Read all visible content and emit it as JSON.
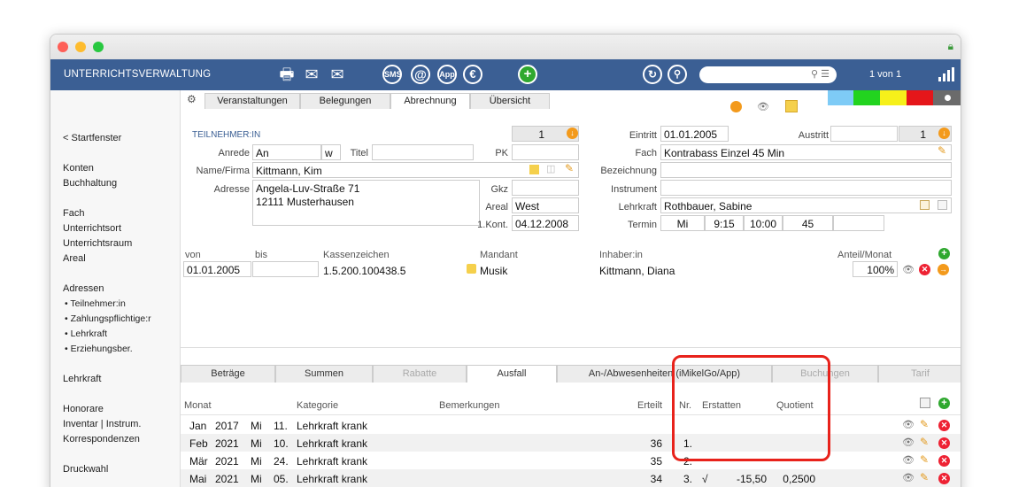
{
  "app": {
    "title": "UNTERRICHTSVERWALTUNG",
    "pager": "1 von 1",
    "search_placeholder": ""
  },
  "toolbar": {
    "sms": "SMS",
    "at": "@",
    "app": "App",
    "euro": "€",
    "plus": "+"
  },
  "sidebar": {
    "items": [
      "< Startfenster",
      "Konten",
      "Buchhaltung",
      "Fach",
      "Unterrichtsort",
      "Unterrichtsraum",
      "Areal",
      "Adressen",
      "• Teilnehmer:in",
      "• Zahlungspflichtige:r",
      "• Lehrkraft",
      "• Erziehungsber.",
      "Lehrkraft",
      "Honorare",
      "Inventar | Instrum.",
      "Korrespondenzen",
      "Druckwahl"
    ]
  },
  "tabs": [
    "Veranstaltungen",
    "Belegungen",
    "Abrechnung",
    "Übersicht"
  ],
  "swatch_colors": [
    "#7ecbf6",
    "#22d31f",
    "#f6f01a",
    "#e5161a",
    "#6b6b6b"
  ],
  "form": {
    "section": "TEILNEHMER:IN",
    "counter": "1",
    "anrede_label": "Anrede",
    "anrede": "An",
    "w": "w",
    "titel_label": "Titel",
    "titel": "",
    "pk_label": "PK",
    "pk": "",
    "name_label": "Name/Firma",
    "name": "Kittmann, Kim",
    "adresse_label": "Adresse",
    "street": "Angela-Luv-Straße 71",
    "city": "12111 Musterhausen",
    "gkz_label": "Gkz",
    "gkz": "",
    "areal_label": "Areal",
    "areal": "West",
    "kont_label": "1.Kont.",
    "kont": "04.12.2008",
    "eintritt_label": "Eintritt",
    "eintritt": "01.01.2005",
    "austritt_label": "Austritt",
    "austritt": "",
    "austritt_counter": "1",
    "fach_label": "Fach",
    "fach": "Kontrabass Einzel 45 Min",
    "bezeichnung_label": "Bezeichnung",
    "bezeichnung": "",
    "instrument_label": "Instrument",
    "instrument": "",
    "lehrkraft_label": "Lehrkraft",
    "lehrkraft": "Rothbauer, Sabine",
    "termin_label": "Termin",
    "termin_day": "Mi",
    "termin_from": "9:15",
    "termin_to": "10:00",
    "termin_min": "45"
  },
  "payment": {
    "headers": {
      "von": "von",
      "bis": "bis",
      "kassenzeichen": "Kassenzeichen",
      "mandant": "Mandant",
      "inhaber": "Inhaber:in",
      "anteil": "Anteil/Monat"
    },
    "row": {
      "von": "01.01.2005",
      "bis": "",
      "kassenzeichen": "1.5.200.100438.5",
      "mandant": "Musik",
      "inhaber": "Kittmann, Diana",
      "anteil": "100%"
    }
  },
  "bottom_tabs": [
    "Beträge",
    "Summen",
    "Rabatte",
    "Ausfall",
    "An-/Abwesenheiten (iMikelGo/App)",
    "Buchungen",
    "Tarif"
  ],
  "ausfall": {
    "headers": {
      "monat": "Monat",
      "kategorie": "Kategorie",
      "bemerkungen": "Bemerkungen",
      "erteilt": "Erteilt",
      "nr": "Nr.",
      "erstatten": "Erstatten",
      "quotient": "Quotient"
    },
    "rows": [
      {
        "month": "Jan",
        "year": "2017",
        "day": "Mi",
        "date": "11.",
        "category": "Lehrkraft krank",
        "erteilt": "",
        "nr": "",
        "check": "",
        "erstatten": "",
        "quotient": ""
      },
      {
        "month": "Feb",
        "year": "2021",
        "day": "Mi",
        "date": "10.",
        "category": "Lehrkraft krank",
        "erteilt": "36",
        "nr": "1.",
        "check": "",
        "erstatten": "",
        "quotient": ""
      },
      {
        "month": "Mär",
        "year": "2021",
        "day": "Mi",
        "date": "24.",
        "category": "Lehrkraft krank",
        "erteilt": "35",
        "nr": "2.",
        "check": "",
        "erstatten": "",
        "quotient": ""
      },
      {
        "month": "Mai",
        "year": "2021",
        "day": "Mi",
        "date": "05.",
        "category": "Lehrkraft krank",
        "erteilt": "34",
        "nr": "3.",
        "check": "√",
        "erstatten": "-15,50",
        "quotient": "0,2500"
      }
    ]
  }
}
